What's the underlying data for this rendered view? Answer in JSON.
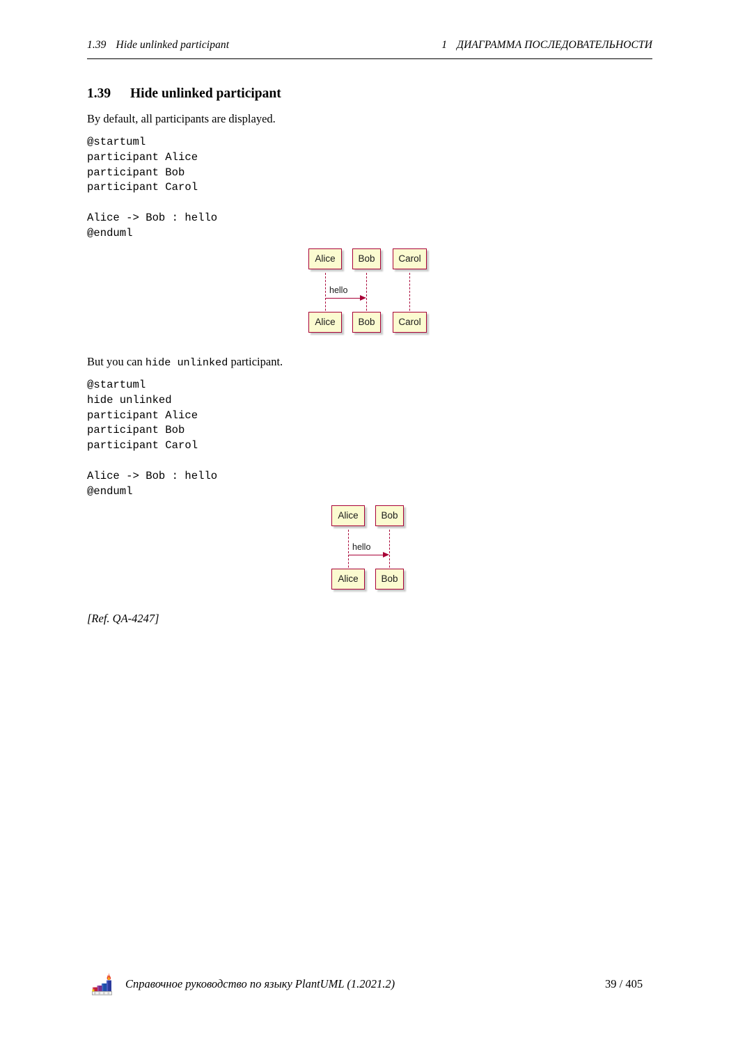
{
  "header": {
    "left_number": "1.39",
    "left_title": "Hide unlinked participant",
    "right_number": "1",
    "right_title": "ДИАГРАММА ПОСЛЕДОВАТЕЛЬНОСТИ"
  },
  "section": {
    "number": "1.39",
    "title": "Hide unlinked participant"
  },
  "paragraphs": {
    "intro": "By default, all participants are displayed.",
    "second_before": "But you can ",
    "second_code": "hide unlinked",
    "second_after": " participant."
  },
  "code_blocks": {
    "first": "@startuml\nparticipant Alice\nparticipant Bob\nparticipant Carol\n\nAlice -> Bob : hello\n@enduml",
    "second": "@startuml\nhide unlinked\nparticipant Alice\nparticipant Bob\nparticipant Carol\n\nAlice -> Bob : hello\n@enduml"
  },
  "diagram_one": {
    "participants": [
      "Alice",
      "Bob",
      "Carol"
    ],
    "message_label": "hello",
    "message_from": "Alice",
    "message_to": "Bob"
  },
  "diagram_two": {
    "participants": [
      "Alice",
      "Bob"
    ],
    "message_label": "hello",
    "message_from": "Alice",
    "message_to": "Bob"
  },
  "reference": "[Ref. QA-4247]",
  "footer": {
    "text": "Справочное руководство по языку PlantUML (1.2021.2)",
    "page": "39 / 405"
  },
  "colors": {
    "box_fill": "#fbfbd0",
    "box_border": "#a80036",
    "arrow": "#a80036",
    "text": "#000000"
  }
}
